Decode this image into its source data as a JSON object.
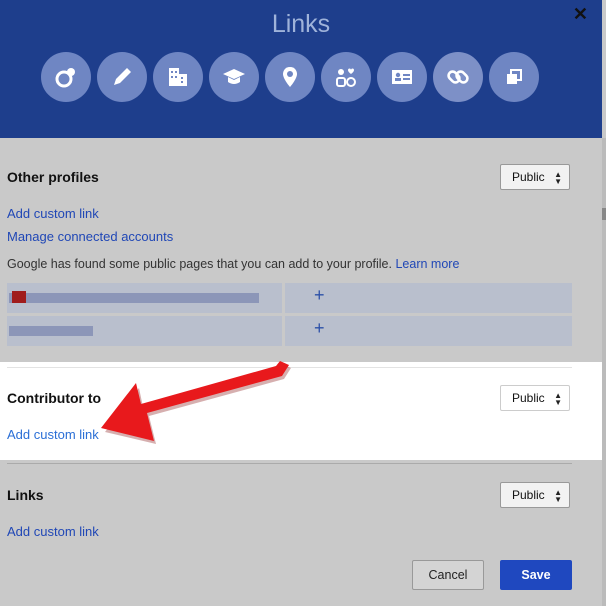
{
  "dialog": {
    "title": "Links",
    "close_label": "✕"
  },
  "icon_tabs": [
    {
      "icon": "circles-icon"
    },
    {
      "icon": "pencil-icon"
    },
    {
      "icon": "building-icon"
    },
    {
      "icon": "graduation-cap-icon"
    },
    {
      "icon": "location-pin-icon"
    },
    {
      "icon": "relationship-icon"
    },
    {
      "icon": "contact-card-icon"
    },
    {
      "icon": "link-icon",
      "active": true
    },
    {
      "icon": "squares-icon"
    }
  ],
  "other_profiles": {
    "title": "Other profiles",
    "visibility": "Public",
    "add_link": "Add custom link",
    "manage_link": "Manage connected accounts",
    "description": "Google has found some public pages that you can add to your profile.",
    "learn_more": "Learn more",
    "suggestions": [
      {
        "plus": "+"
      },
      {
        "plus": "+"
      }
    ]
  },
  "contributor_to": {
    "title": "Contributor to",
    "visibility": "Public",
    "add_link": "Add custom link"
  },
  "links": {
    "title": "Links",
    "visibility": "Public",
    "add_link": "Add custom link"
  },
  "footer": {
    "cancel_label": "Cancel",
    "save_label": "Save"
  },
  "colors": {
    "header": "#1e3e8c",
    "link": "#2047b6",
    "save": "#1f48bf",
    "arrow": "#e8191c"
  }
}
